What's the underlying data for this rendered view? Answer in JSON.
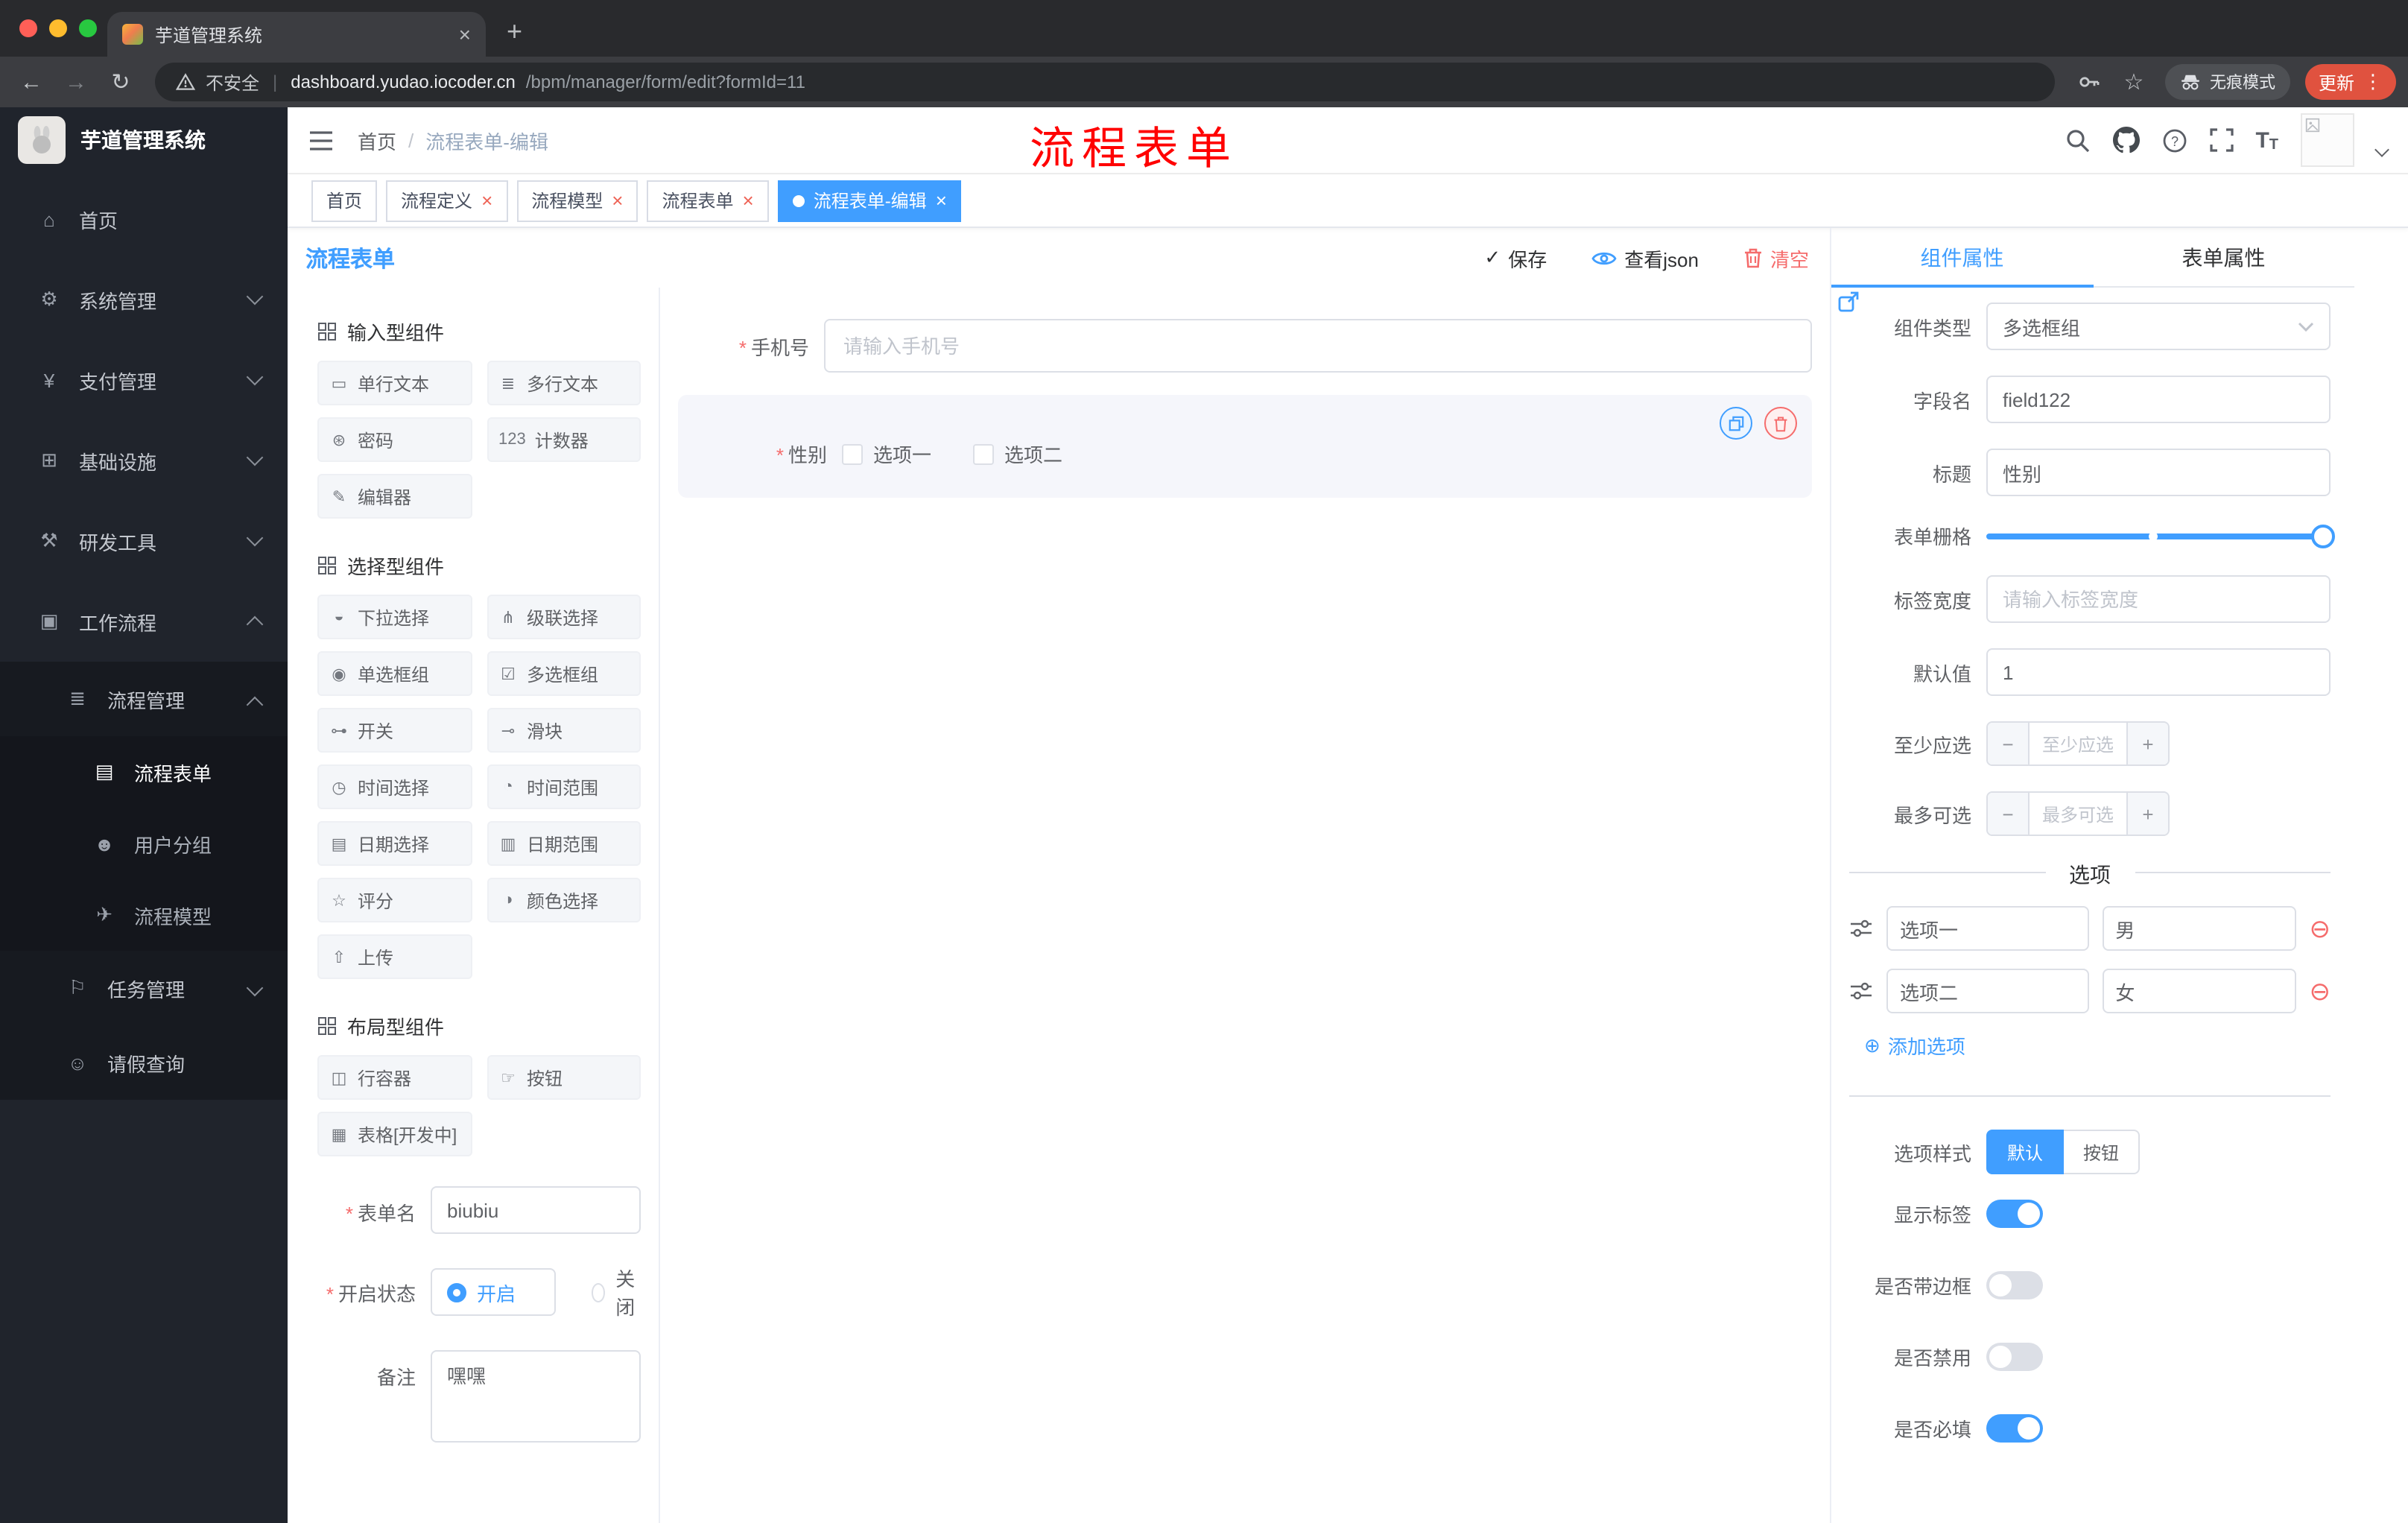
{
  "browser": {
    "tab": {
      "title": "芋道管理系统"
    },
    "address": {
      "security": "不安全",
      "host": "dashboard.yudao.iocoder.cn",
      "path": "/bpm/manager/form/edit?formId=11"
    },
    "incognito_label": "无痕模式",
    "update_label": "更新"
  },
  "sidebar": {
    "logo_title": "芋道管理系统",
    "items": [
      {
        "label": "首页",
        "icon": "home-icon",
        "glyph": "⌂"
      },
      {
        "label": "系统管理",
        "icon": "system-management-icon",
        "glyph": "⚙",
        "expanded": false
      },
      {
        "label": "支付管理",
        "icon": "payment-management-icon",
        "glyph": "¥",
        "expanded": false
      },
      {
        "label": "基础设施",
        "icon": "infrastructure-icon",
        "glyph": "⊞",
        "expanded": false
      },
      {
        "label": "研发工具",
        "icon": "dev-tools-icon",
        "glyph": "⚒",
        "expanded": false
      },
      {
        "label": "工作流程",
        "icon": "workflow-icon",
        "glyph": "▣",
        "expanded": true
      },
      {
        "label": "流程管理",
        "icon": "process-management-icon",
        "glyph": "≣",
        "expanded": true
      },
      {
        "label": "流程表单",
        "icon": "process-form-icon",
        "glyph": "▤",
        "active": true
      },
      {
        "label": "用户分组",
        "icon": "user-group-icon",
        "glyph": "☻"
      },
      {
        "label": "流程模型",
        "icon": "process-model-icon",
        "glyph": "✈"
      },
      {
        "label": "任务管理",
        "icon": "task-management-icon",
        "glyph": "⚐",
        "expanded": false
      },
      {
        "label": "请假查询",
        "icon": "leave-query-icon",
        "glyph": "☺"
      }
    ]
  },
  "header": {
    "breadcrumb": [
      "首页",
      "流程表单-编辑"
    ],
    "annotation": "流程表单"
  },
  "tags": [
    {
      "label": "首页"
    },
    {
      "label": "流程定义"
    },
    {
      "label": "流程模型"
    },
    {
      "label": "流程表单"
    },
    {
      "label": "流程表单-编辑"
    }
  ],
  "designer": {
    "title": "流程表单",
    "actions": {
      "save": "保存",
      "view_json": "查看json",
      "clear": "清空"
    },
    "palette": {
      "sections": [
        {
          "title": "输入型组件",
          "items": [
            {
              "label": "单行文本",
              "icon": "single-line-text-icon",
              "glyph": "▭"
            },
            {
              "label": "多行文本",
              "icon": "multiline-text-icon",
              "glyph": "≣"
            },
            {
              "label": "密码",
              "icon": "password-icon",
              "glyph": "⊛"
            },
            {
              "label": "计数器",
              "icon": "counter-icon",
              "glyph": "123"
            },
            {
              "label": "编辑器",
              "icon": "editor-icon",
              "glyph": "✎"
            }
          ]
        },
        {
          "title": "选择型组件",
          "items": [
            {
              "label": "下拉选择",
              "icon": "select-icon",
              "glyph": "◒"
            },
            {
              "label": "级联选择",
              "icon": "cascader-icon",
              "glyph": "⋔"
            },
            {
              "label": "单选框组",
              "icon": "radio-group-icon",
              "glyph": "◉"
            },
            {
              "label": "多选框组",
              "icon": "checkbox-group-icon",
              "glyph": "☑"
            },
            {
              "label": "开关",
              "icon": "switch-icon",
              "glyph": "⊶"
            },
            {
              "label": "滑块",
              "icon": "slider-icon",
              "glyph": "⊸"
            },
            {
              "label": "时间选择",
              "icon": "time-picker-icon",
              "glyph": "◷"
            },
            {
              "label": "时间范围",
              "icon": "time-range-icon",
              "glyph": "◔"
            },
            {
              "label": "日期选择",
              "icon": "date-picker-icon",
              "glyph": "▤"
            },
            {
              "label": "日期范围",
              "icon": "date-range-icon",
              "glyph": "▥"
            },
            {
              "label": "评分",
              "icon": "rate-icon",
              "glyph": "☆"
            },
            {
              "label": "颜色选择",
              "icon": "color-picker-icon",
              "glyph": "◑"
            },
            {
              "label": "上传",
              "icon": "upload-icon",
              "glyph": "⇧"
            }
          ]
        },
        {
          "title": "布局型组件",
          "items": [
            {
              "label": "行容器",
              "icon": "row-container-icon",
              "glyph": "◫"
            },
            {
              "label": "按钮",
              "icon": "button-icon",
              "glyph": "☞"
            },
            {
              "label": "表格[开发中]",
              "icon": "table-icon",
              "glyph": "▦"
            }
          ]
        }
      ]
    },
    "form": {
      "name_label": "表单名",
      "name_value": "biubiu",
      "status_label": "开启状态",
      "status_on": "开启",
      "status_off": "关闭",
      "remark_label": "备注",
      "remark_value": "嘿嘿"
    },
    "canvas": {
      "phone": {
        "label": "手机号",
        "placeholder": "请输入手机号"
      },
      "gender": {
        "label": "性别",
        "options": [
          "选项一",
          "选项二"
        ]
      }
    }
  },
  "props": {
    "tabs": [
      "组件属性",
      "表单属性"
    ],
    "fields": {
      "component_type": {
        "label": "组件类型",
        "value": "多选框组"
      },
      "field_name": {
        "label": "字段名",
        "value": "field122"
      },
      "title": {
        "label": "标题",
        "value": "性别"
      },
      "grid": {
        "label": "表单栅格"
      },
      "label_width": {
        "label": "标签宽度",
        "placeholder": "请输入标签宽度"
      },
      "default_value": {
        "label": "默认值",
        "value": "1"
      },
      "min_select": {
        "label": "至少应选",
        "placeholder": "至少应选"
      },
      "max_select": {
        "label": "最多可选",
        "placeholder": "最多可选"
      }
    },
    "options_divider": "选项",
    "options": [
      {
        "label": "选项一",
        "value": "男"
      },
      {
        "label": "选项二",
        "value": "女"
      }
    ],
    "add_option": "添加选项",
    "option_style": {
      "label": "选项样式",
      "choices": [
        "默认",
        "按钮"
      ],
      "active": "默认"
    },
    "switches": [
      {
        "label": "显示标签",
        "on": true
      },
      {
        "label": "是否带边框",
        "on": false
      },
      {
        "label": "是否禁用",
        "on": false
      },
      {
        "label": "是否必填",
        "on": true
      }
    ],
    "colors": {
      "accent": "#409EFF",
      "danger": "#F56C6C"
    }
  }
}
